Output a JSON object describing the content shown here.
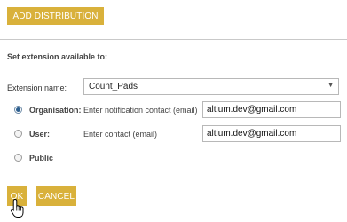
{
  "add_distribution_label": "ADD DISTRIBUTION",
  "section_title": "Set extension available to:",
  "extension": {
    "label": "Extension name:",
    "selected": "Count_Pads"
  },
  "options": {
    "organisation": {
      "label": "Organisation:",
      "hint": "Enter notification contact (email)",
      "value": "altium.dev@gmail.com",
      "checked": true
    },
    "user": {
      "label": "User:",
      "hint": "Enter contact (email)",
      "value": "altium.dev@gmail.com",
      "checked": false
    },
    "public": {
      "label": "Public",
      "checked": false
    }
  },
  "buttons": {
    "ok": "OK",
    "cancel": "CANCEL"
  },
  "colors": {
    "accent": "#d9b13b",
    "radio_selected": "#2d5f8f"
  },
  "icons": {
    "select_caret": "chevron-down-icon",
    "cursor": "hand-pointer-icon"
  }
}
